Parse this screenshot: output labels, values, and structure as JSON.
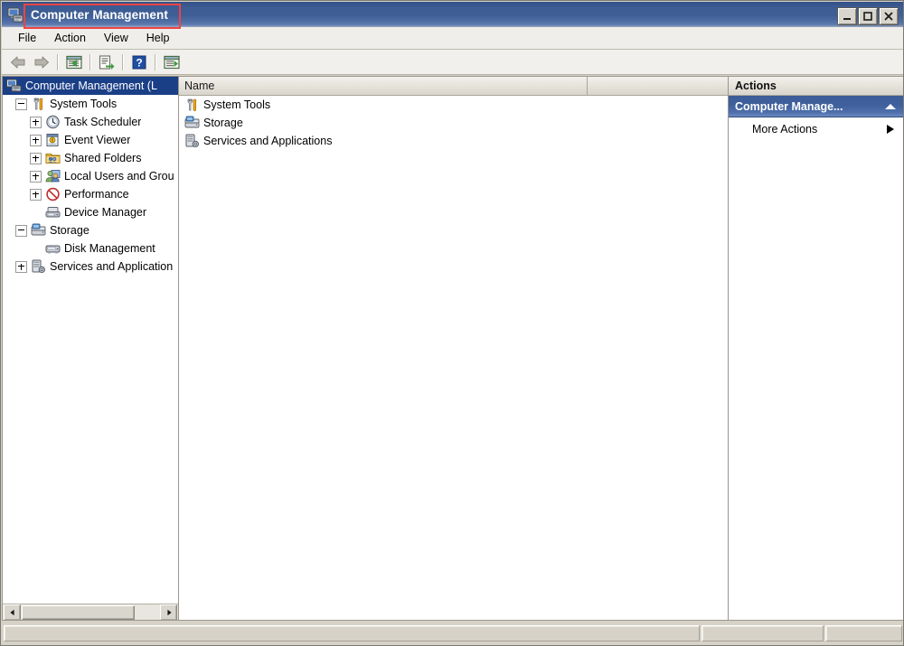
{
  "window": {
    "title": "Computer Management",
    "title_icon": "computer-management-icon",
    "controls": {
      "minimize": "minimize-button",
      "maximize": "maximize-button",
      "close": "close-button"
    },
    "annotation": {
      "type": "highlight-rectangle",
      "color": "#ef4444",
      "target": "Computer Management"
    }
  },
  "menu": {
    "items": [
      {
        "label": "File"
      },
      {
        "label": "Action"
      },
      {
        "label": "View"
      },
      {
        "label": "Help"
      }
    ]
  },
  "toolbar": {
    "buttons": [
      {
        "name": "back-arrow-icon",
        "label": "Back",
        "enabled": false
      },
      {
        "name": "forward-arrow-icon",
        "label": "Forward",
        "enabled": false
      },
      {
        "name": "show-hide-console-tree-icon",
        "label": "Show/Hide Console Tree",
        "enabled": true
      },
      {
        "name": "export-list-icon",
        "label": "Export List",
        "enabled": true
      },
      {
        "name": "help-icon",
        "label": "Help",
        "enabled": true
      },
      {
        "name": "show-hide-action-pane-icon",
        "label": "Show/Hide Action Pane",
        "enabled": true
      }
    ]
  },
  "tree": {
    "nodes": [
      {
        "label": "Computer Management (L",
        "icon": "computer-icon",
        "indent": 0,
        "expander": "none",
        "selected": true
      },
      {
        "label": "System Tools",
        "icon": "system-tools-icon",
        "indent": 1,
        "expander": "minus",
        "selected": false
      },
      {
        "label": "Task Scheduler",
        "icon": "clock-icon",
        "indent": 2,
        "expander": "plus",
        "selected": false
      },
      {
        "label": "Event Viewer",
        "icon": "event-viewer-icon",
        "indent": 2,
        "expander": "plus",
        "selected": false
      },
      {
        "label": "Shared Folders",
        "icon": "shared-folders-icon",
        "indent": 2,
        "expander": "plus",
        "selected": false
      },
      {
        "label": "Local Users and Grou",
        "icon": "users-icon",
        "indent": 2,
        "expander": "plus",
        "selected": false
      },
      {
        "label": "Performance",
        "icon": "performance-icon",
        "indent": 2,
        "expander": "plus",
        "selected": false
      },
      {
        "label": "Device Manager",
        "icon": "device-manager-icon",
        "indent": 2,
        "expander": "none",
        "selected": false
      },
      {
        "label": "Storage",
        "icon": "storage-icon",
        "indent": 1,
        "expander": "minus",
        "selected": false
      },
      {
        "label": "Disk Management",
        "icon": "disk-management-icon",
        "indent": 2,
        "expander": "none",
        "selected": false
      },
      {
        "label": "Services and Application",
        "icon": "services-icon",
        "indent": 1,
        "expander": "plus",
        "selected": false
      }
    ],
    "scrollbar": {
      "horizontal": true,
      "thumb_percent": 82
    }
  },
  "list": {
    "columns": [
      {
        "label": "Name"
      },
      {
        "label": ""
      }
    ],
    "rows": [
      {
        "name": "System Tools",
        "icon": "system-tools-icon"
      },
      {
        "name": "Storage",
        "icon": "storage-icon"
      },
      {
        "name": "Services and Applications",
        "icon": "services-icon"
      }
    ]
  },
  "actions": {
    "header": "Actions",
    "group": {
      "label": "Computer Manage...",
      "chevron": "chevron-up-icon",
      "expanded": true
    },
    "items": [
      {
        "label": "More Actions",
        "submenu": true
      }
    ]
  },
  "statusbar": {
    "main": "",
    "secondary": "",
    "third": ""
  },
  "colors": {
    "titlebar_blue": "#3e5e95",
    "selection_blue": "#1b3f87",
    "chrome_gray": "#d6d2c7",
    "annotation_red": "#ef4444"
  }
}
